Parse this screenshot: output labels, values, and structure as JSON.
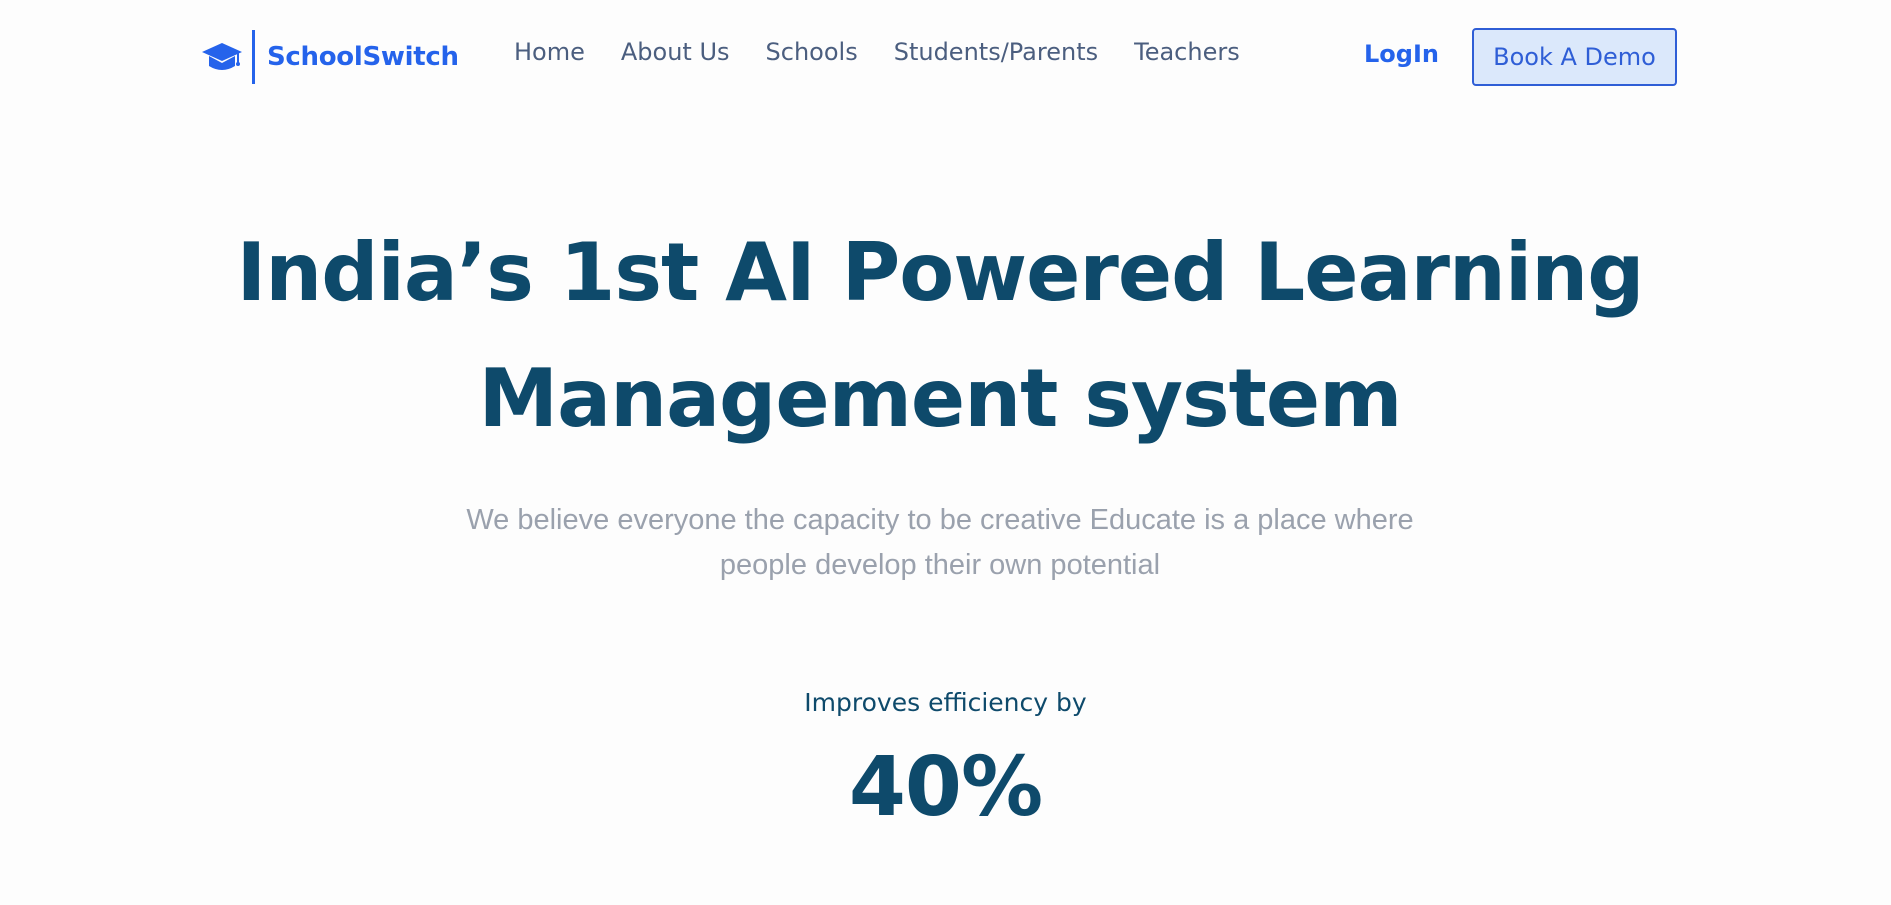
{
  "brand": {
    "name": "SchoolSwitch",
    "logo_icon": "graduation-cap-icon",
    "color": "#2563eb"
  },
  "nav": {
    "links": [
      {
        "label": "Home"
      },
      {
        "label": "About Us"
      },
      {
        "label": "Schools"
      },
      {
        "label": "Students/Parents"
      },
      {
        "label": "Teachers"
      }
    ],
    "login_label": "LogIn",
    "demo_label": "Book A Demo"
  },
  "hero": {
    "title": "India’s 1st AI Powered Learning Management system",
    "subtitle": "We believe everyone the capacity to be creative Educate is a place where people develop their own potential"
  },
  "stat": {
    "label": "Improves efficiency by",
    "value": "40%"
  },
  "colors": {
    "heading": "#0e4a6b",
    "nav_text": "#4b5e7f",
    "subtitle": "#9aa1ad",
    "button_bg": "#dbe8fb"
  }
}
